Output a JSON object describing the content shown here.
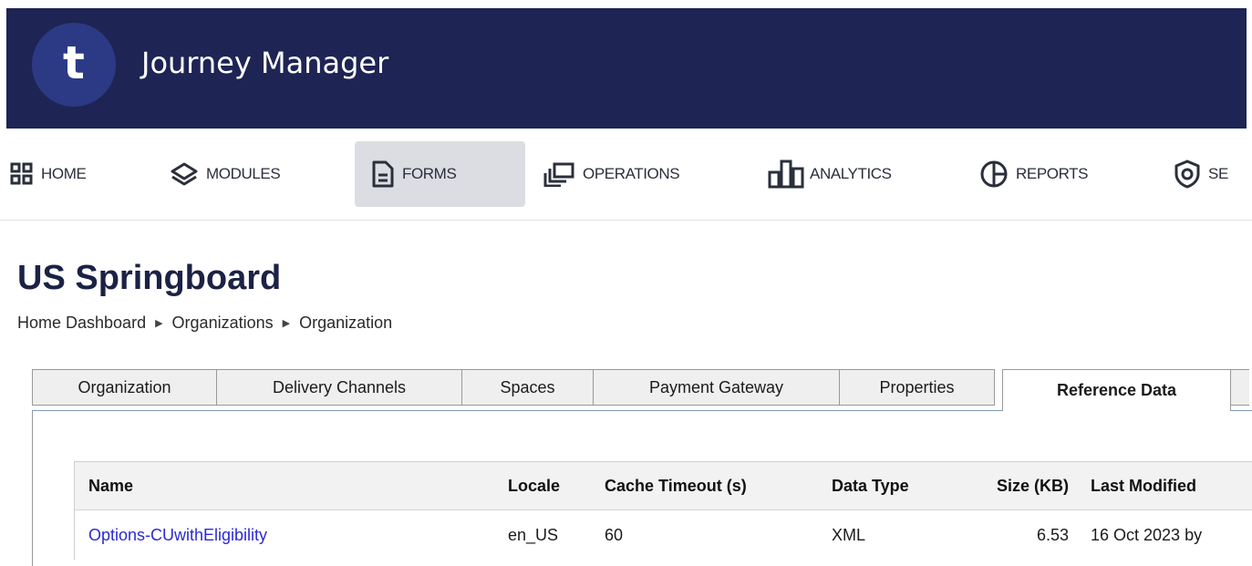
{
  "app": {
    "title": "Journey Manager",
    "logo_letter": "t",
    "header_color": "#1e2454"
  },
  "nav": {
    "items": [
      {
        "label": "HOME",
        "icon": "grid-icon"
      },
      {
        "label": "MODULES",
        "icon": "layers-icon"
      },
      {
        "label": "FORMS",
        "icon": "document-icon",
        "active": true
      },
      {
        "label": "OPERATIONS",
        "icon": "windows-icon"
      },
      {
        "label": "ANALYTICS",
        "icon": "bar-chart-icon"
      },
      {
        "label": "REPORTS",
        "icon": "pie-chart-icon"
      },
      {
        "label": "SE",
        "icon": "shield-icon"
      }
    ]
  },
  "page": {
    "title": "US Springboard",
    "breadcrumb": [
      "Home Dashboard",
      "Organizations",
      "Organization"
    ]
  },
  "tabs": [
    {
      "label": "Organization"
    },
    {
      "label": "Delivery Channels"
    },
    {
      "label": "Spaces"
    },
    {
      "label": "Payment Gateway"
    },
    {
      "label": "Properties"
    },
    {
      "label": "Reference Data",
      "active": true
    }
  ],
  "table": {
    "columns": {
      "name": "Name",
      "locale": "Locale",
      "cache": "Cache Timeout (s)",
      "type": "Data Type",
      "size": "Size (KB)",
      "modified": "Last Modified"
    },
    "rows": [
      {
        "name": "Options-CUwithEligibility",
        "locale": "en_US",
        "cache": "60",
        "type": "XML",
        "size": "6.53",
        "modified": "16 Oct 2023 by"
      }
    ]
  }
}
